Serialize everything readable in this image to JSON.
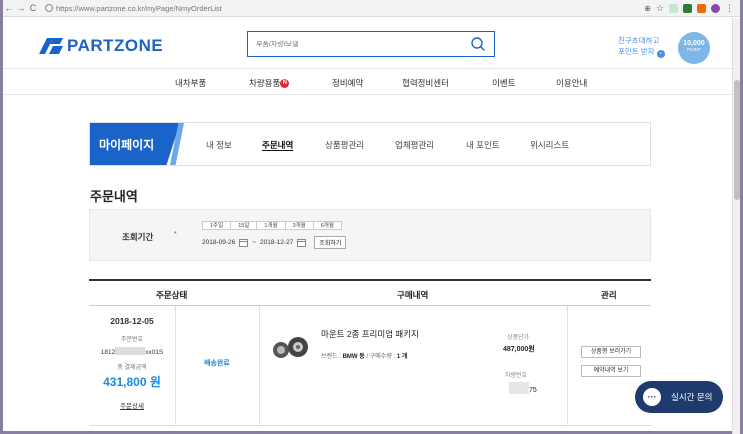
{
  "browser": {
    "url": "https://www.partzone.co.kr/myPage/NmyOrderList"
  },
  "header": {
    "logo": "PARTZONE",
    "search_placeholder": "부품/차량/모델",
    "invite_line1": "친구초대하고",
    "invite_line2": "포인트 받자",
    "badge_value": "10,000",
    "badge_unit": "POINT"
  },
  "nav": {
    "items": [
      "내차부품",
      "차량용품",
      "정비예약",
      "협력정비센터",
      "이벤트",
      "이용안내"
    ],
    "new_badge": "N"
  },
  "mypage": {
    "banner": "마이페이지",
    "tabs": [
      "내 정보",
      "주문내역",
      "상품평관리",
      "업체평관리",
      "내 포인트",
      "위시리스트"
    ],
    "active_tab": "주문내역"
  },
  "page_title": "주문내역",
  "filter": {
    "label": "조회기간",
    "required_mark": "*",
    "periods": [
      "1주일",
      "15일",
      "1개월",
      "3개월",
      "6개월"
    ],
    "start_date": "2018-09-26",
    "end_date": "2018-12-27",
    "separator": "~",
    "search_button": "조회하기"
  },
  "table": {
    "headers": [
      "주문상태",
      "구매내역",
      "관리"
    ],
    "rows": [
      {
        "date": "2018-12-05",
        "order_no_label": "주문번호",
        "order_no_prefix": "1812",
        "order_no_suffix": "xx01S",
        "total_label": "총 결제금액",
        "total": "431,800 원",
        "detail_link": "주문상세",
        "status": "배송완료",
        "product_name": "마운트 2종 프리미엄 패키지",
        "brand_label": "브랜드 :",
        "brand": "BMW 등",
        "qty_label": "/ 구매수량 :",
        "qty": "1 개",
        "price_label": "상품단가",
        "price": "487,000원",
        "car_label": "차량번호",
        "car_suffix": "75",
        "buttons": [
          "상품평 보러가기",
          "예약내역 보기"
        ]
      }
    ]
  },
  "chat": {
    "icon": "chat-bubble-icon",
    "label": "실시간 문의"
  },
  "colors": {
    "brand": "#1a63c9",
    "accent": "#1a8be0",
    "badge_red": "#e0252b",
    "chat_bg": "#1f3b6d"
  }
}
